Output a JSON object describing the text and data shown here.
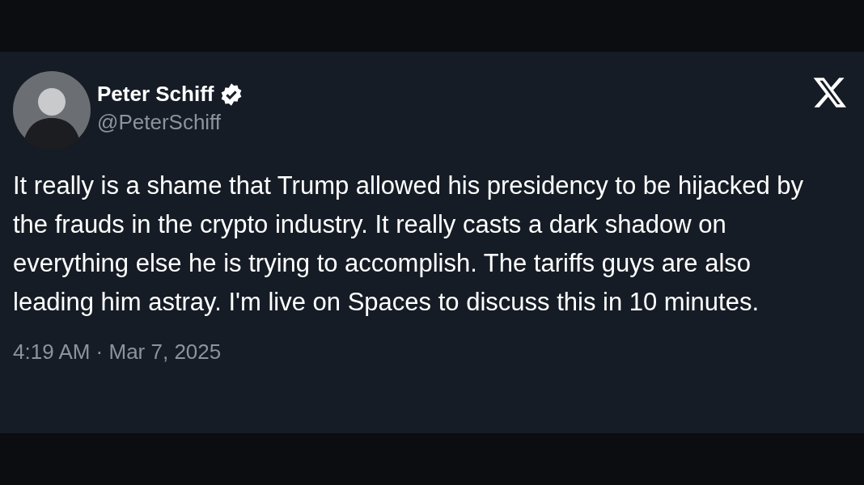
{
  "post": {
    "author": {
      "name": "Peter Schiff",
      "handle": "@PeterSchiff",
      "verified": true
    },
    "text": "It really is a shame that Trump allowed his presidency to be hijacked by the frauds in the crypto industry. It really casts a dark shadow on everything else he is trying to accomplish. The tariffs guys are also leading him astray. I'm live on Spaces to discuss this in 10 minutes.",
    "timestamp": "4:19 AM · Mar 7, 2025"
  }
}
